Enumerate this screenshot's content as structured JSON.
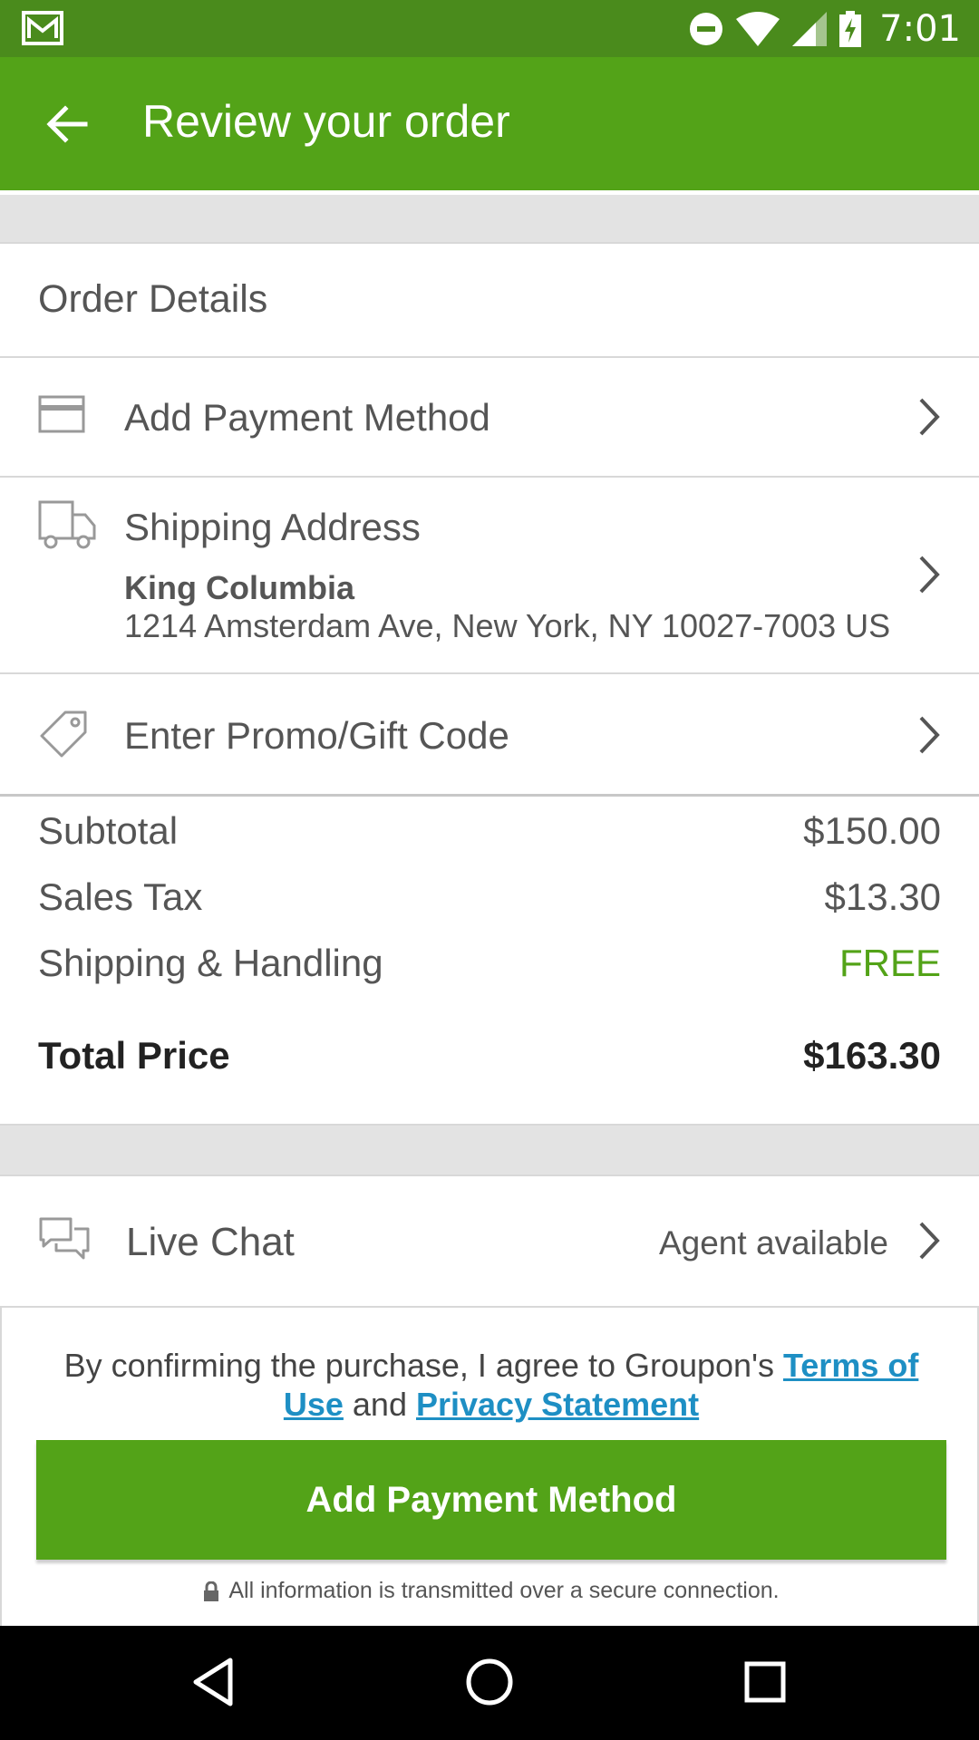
{
  "status_bar": {
    "time": "7:01"
  },
  "app_bar": {
    "title": "Review your order"
  },
  "order_details": {
    "title": "Order Details"
  },
  "payment_row": {
    "label": "Add Payment Method"
  },
  "shipping_row": {
    "label": "Shipping Address",
    "name": "King Columbia",
    "address": "1214 Amsterdam Ave, New York, NY 10027-7003 US"
  },
  "promo_row": {
    "label": "Enter Promo/Gift Code"
  },
  "summary": {
    "subtotal_label": "Subtotal",
    "subtotal_value": "$150.00",
    "tax_label": "Sales Tax",
    "tax_value": "$13.30",
    "shipping_label": "Shipping & Handling",
    "shipping_value": "FREE",
    "total_label": "Total Price",
    "total_value": "$163.30"
  },
  "live_chat": {
    "label": "Live Chat",
    "status": "Agent available"
  },
  "terms": {
    "prefix": "By confirming the purchase, I agree to Groupon's ",
    "terms_link": "Terms of Use",
    "and": " and ",
    "privacy_link": "Privacy Statement"
  },
  "cta": {
    "label": "Add Payment Method"
  },
  "secure_note": "All information is transmitted over a secure connection.",
  "colors": {
    "brand_green": "#53a318",
    "status_green": "#4a8b1c",
    "link_blue": "#1e8fc4"
  }
}
